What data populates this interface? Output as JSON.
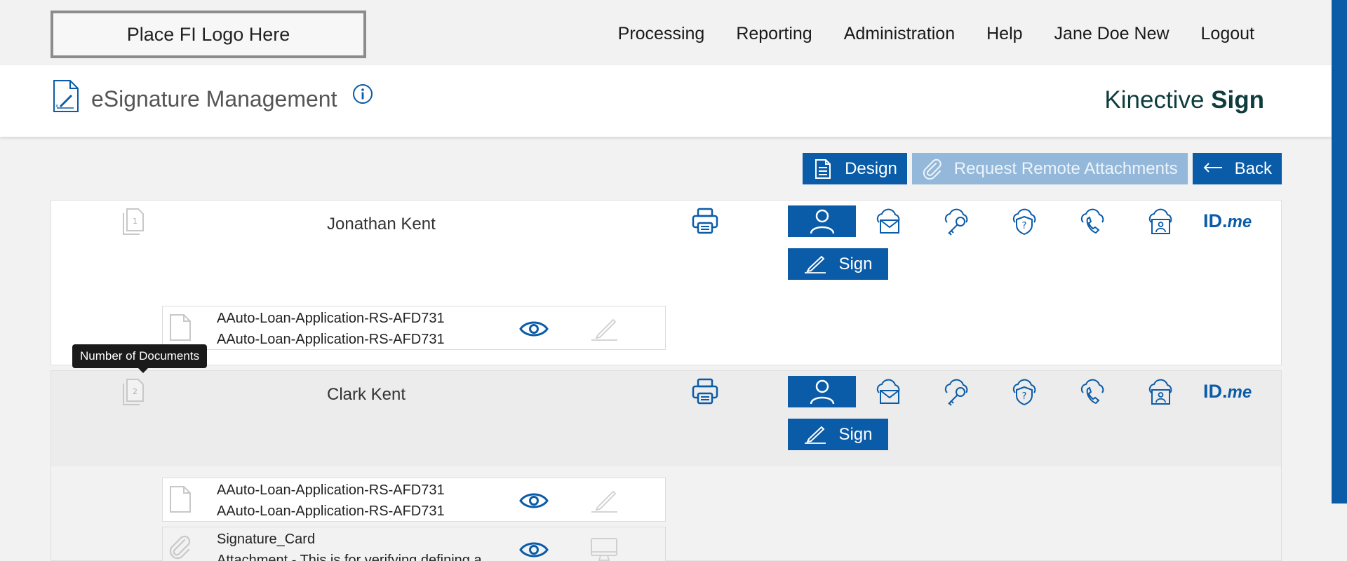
{
  "logo": {
    "text": "Place FI Logo Here"
  },
  "nav": {
    "items": [
      "Processing",
      "Reporting",
      "Administration",
      "Help",
      "Jane Doe New",
      "Logout"
    ]
  },
  "header": {
    "title": "eSignature Management",
    "brand_light": "Kinective",
    "brand_bold": "Sign"
  },
  "actions": {
    "design": "Design",
    "request_attachments": "Request Remote Attachments",
    "back": "Back"
  },
  "tooltip": {
    "text": "Number of Documents"
  },
  "signers": [
    {
      "name": "Jonathan Kent",
      "count": "1",
      "sign_label": "Sign",
      "idme_prefix": "ID.",
      "idme_suffix": "me",
      "documents": [
        {
          "line1": "AAuto-Loan-Application-RS-AFD731",
          "line2": "AAuto-Loan-Application-RS-AFD731"
        }
      ]
    },
    {
      "name": "Clark Kent",
      "count": "2",
      "sign_label": "Sign",
      "idme_prefix": "ID.",
      "idme_suffix": "me",
      "documents": [
        {
          "line1": "AAuto-Loan-Application-RS-AFD731",
          "line2": "AAuto-Loan-Application-RS-AFD731"
        },
        {
          "line1": "Signature_Card",
          "line2": "Attachment - This is for verifying defining a"
        }
      ]
    }
  ],
  "colors": {
    "primary": "#0a5ba8",
    "disabled": "#94b8da",
    "brand_text": "#0f3d3e"
  }
}
